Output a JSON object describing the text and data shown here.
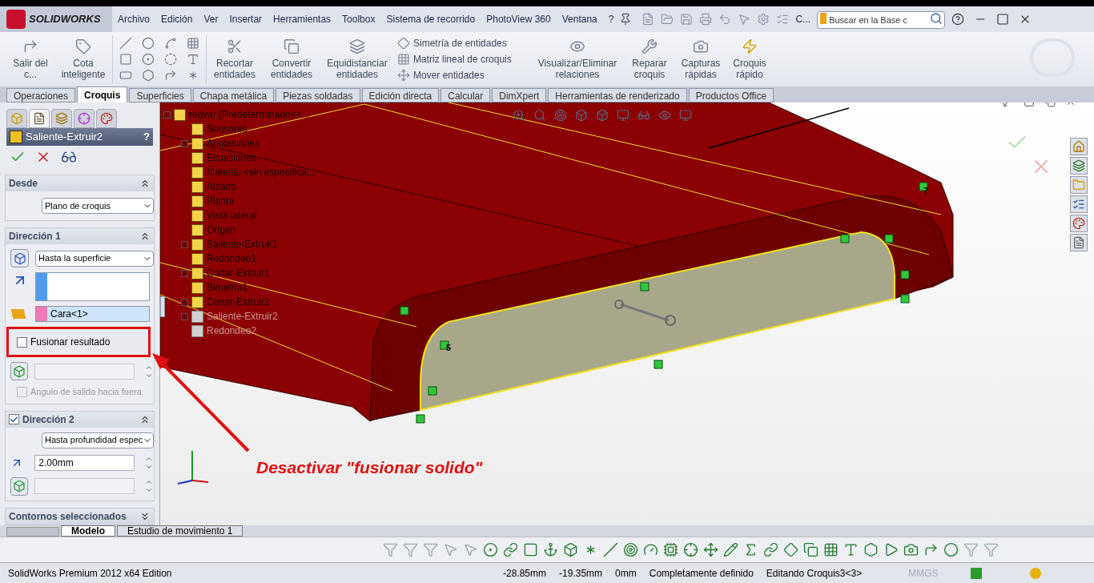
{
  "app": {
    "logo": "SOLIDWORKS"
  },
  "menu": [
    "Archivo",
    "Edición",
    "Ver",
    "Insertar",
    "Herramientas",
    "Toolbox",
    "Sistema de recorrido",
    "PhotoView 360",
    "Ventana",
    "?"
  ],
  "toolbar_more": "C...",
  "search": {
    "placeholder": "Buscar en la Base c"
  },
  "ribbon": [
    {
      "kind": "large",
      "label": "Salir del c..."
    },
    {
      "kind": "large",
      "label": "Cota inteligente"
    },
    {
      "kind": "large",
      "label": "Recortar entidades"
    },
    {
      "kind": "large",
      "label": "Convertir entidades"
    },
    {
      "kind": "large",
      "label": "Equidistanciar entidades"
    },
    {
      "kind": "list",
      "labels": [
        "Simetría de entidades",
        "Matriz lineal de croquis",
        "Mover entidades"
      ]
    },
    {
      "kind": "large",
      "label": "Visualizar/Eliminar relaciones"
    },
    {
      "kind": "large",
      "label": "Reparar croquis"
    },
    {
      "kind": "large",
      "label": "Capturas rápidas"
    },
    {
      "kind": "large",
      "label": "Croquis rápido"
    }
  ],
  "tabs": [
    {
      "label": "Operaciones",
      "selected": false
    },
    {
      "label": "Croquis",
      "selected": true
    },
    {
      "label": "Superficies",
      "selected": false
    },
    {
      "label": "Chapa metálica",
      "selected": false
    },
    {
      "label": "Piezas soldadas",
      "selected": false
    },
    {
      "label": "Edición directa",
      "selected": false
    },
    {
      "label": "Calcular",
      "selected": false
    },
    {
      "label": "DimXpert",
      "selected": false
    },
    {
      "label": "Herramientas de renderizado",
      "selected": false
    },
    {
      "label": "Productos Office",
      "selected": false
    }
  ],
  "property_manager": {
    "tabs": [
      {
        "selected": false
      },
      {
        "selected": true
      },
      {
        "selected": false
      },
      {
        "selected": false
      },
      {
        "selected": false
      }
    ],
    "title": "Saliente-Extruir2",
    "help": "?",
    "sections": [
      {
        "kind": "from",
        "title": "Desde",
        "expanded": true,
        "select": "Plano de croquis"
      },
      {
        "kind": "direction1",
        "title": "Dirección 1",
        "expanded": true,
        "select": "Hasta la superficie",
        "face": "Cara<1>",
        "merge": {
          "label": "Fusionar resultado",
          "checked": false
        },
        "draft": {
          "label": "Ángulo de salida hacia fuera",
          "checked": false,
          "disabled": true
        }
      },
      {
        "kind": "direction2",
        "title": "Dirección 2",
        "checked": true,
        "expanded": true,
        "select": "Hasta profundidad espec",
        "depth": "2.00mm"
      },
      {
        "kind": "contours",
        "title": "Contornos seleccionados",
        "expanded": false
      }
    ]
  },
  "feature_tree": {
    "label": "redvar  (Predeterminado<<...",
    "kind": "expandable",
    "expanded": true,
    "disabled": false,
    "children": [
      {
        "label": "Sensores",
        "kind": "leaf",
        "disabled": false
      },
      {
        "label": "Anotaciones",
        "kind": "expandable",
        "expanded": false,
        "disabled": false
      },
      {
        "label": "Ecuaciones",
        "kind": "leaf",
        "disabled": false
      },
      {
        "label": "Material <sin especifica...",
        "kind": "leaf",
        "disabled": false
      },
      {
        "label": "Alzado",
        "kind": "leaf",
        "disabled": false
      },
      {
        "label": "Planta",
        "kind": "leaf",
        "disabled": false
      },
      {
        "label": "Vista lateral",
        "kind": "leaf",
        "disabled": false
      },
      {
        "label": "Origen",
        "kind": "leaf",
        "disabled": false
      },
      {
        "label": "Saliente-Extruir1",
        "kind": "expandable",
        "expanded": false,
        "disabled": false
      },
      {
        "label": "Redondeo1",
        "kind": "leaf",
        "disabled": false
      },
      {
        "label": "Cortar-Extruir1",
        "kind": "expandable",
        "expanded": false,
        "disabled": false
      },
      {
        "label": "Simetría1",
        "kind": "leaf",
        "disabled": false
      },
      {
        "label": "Cortar-Extruir2",
        "kind": "expandable",
        "expanded": false,
        "disabled": false
      },
      {
        "label": "Saliente-Extruir2",
        "kind": "expandable",
        "expanded": false,
        "disabled": true
      },
      {
        "label": "Redondeo2",
        "kind": "leaf",
        "disabled": true
      }
    ]
  },
  "sketch_labels": [
    "5",
    "7"
  ],
  "annotation": {
    "text": "Desactivar \"fusionar solido\""
  },
  "bottom_tabs": [
    {
      "label": "Modelo",
      "selected": true
    },
    {
      "label": "Estudio de movimiento 1",
      "selected": false
    }
  ],
  "status_bar": {
    "edition": "SolidWorks Premium 2012 x64 Edition",
    "fields": [
      "-28.85mm",
      "-19.35mm",
      "0mm",
      "Completamente definido",
      "Editando Croquis3<3>"
    ],
    "units": "MMGS"
  }
}
